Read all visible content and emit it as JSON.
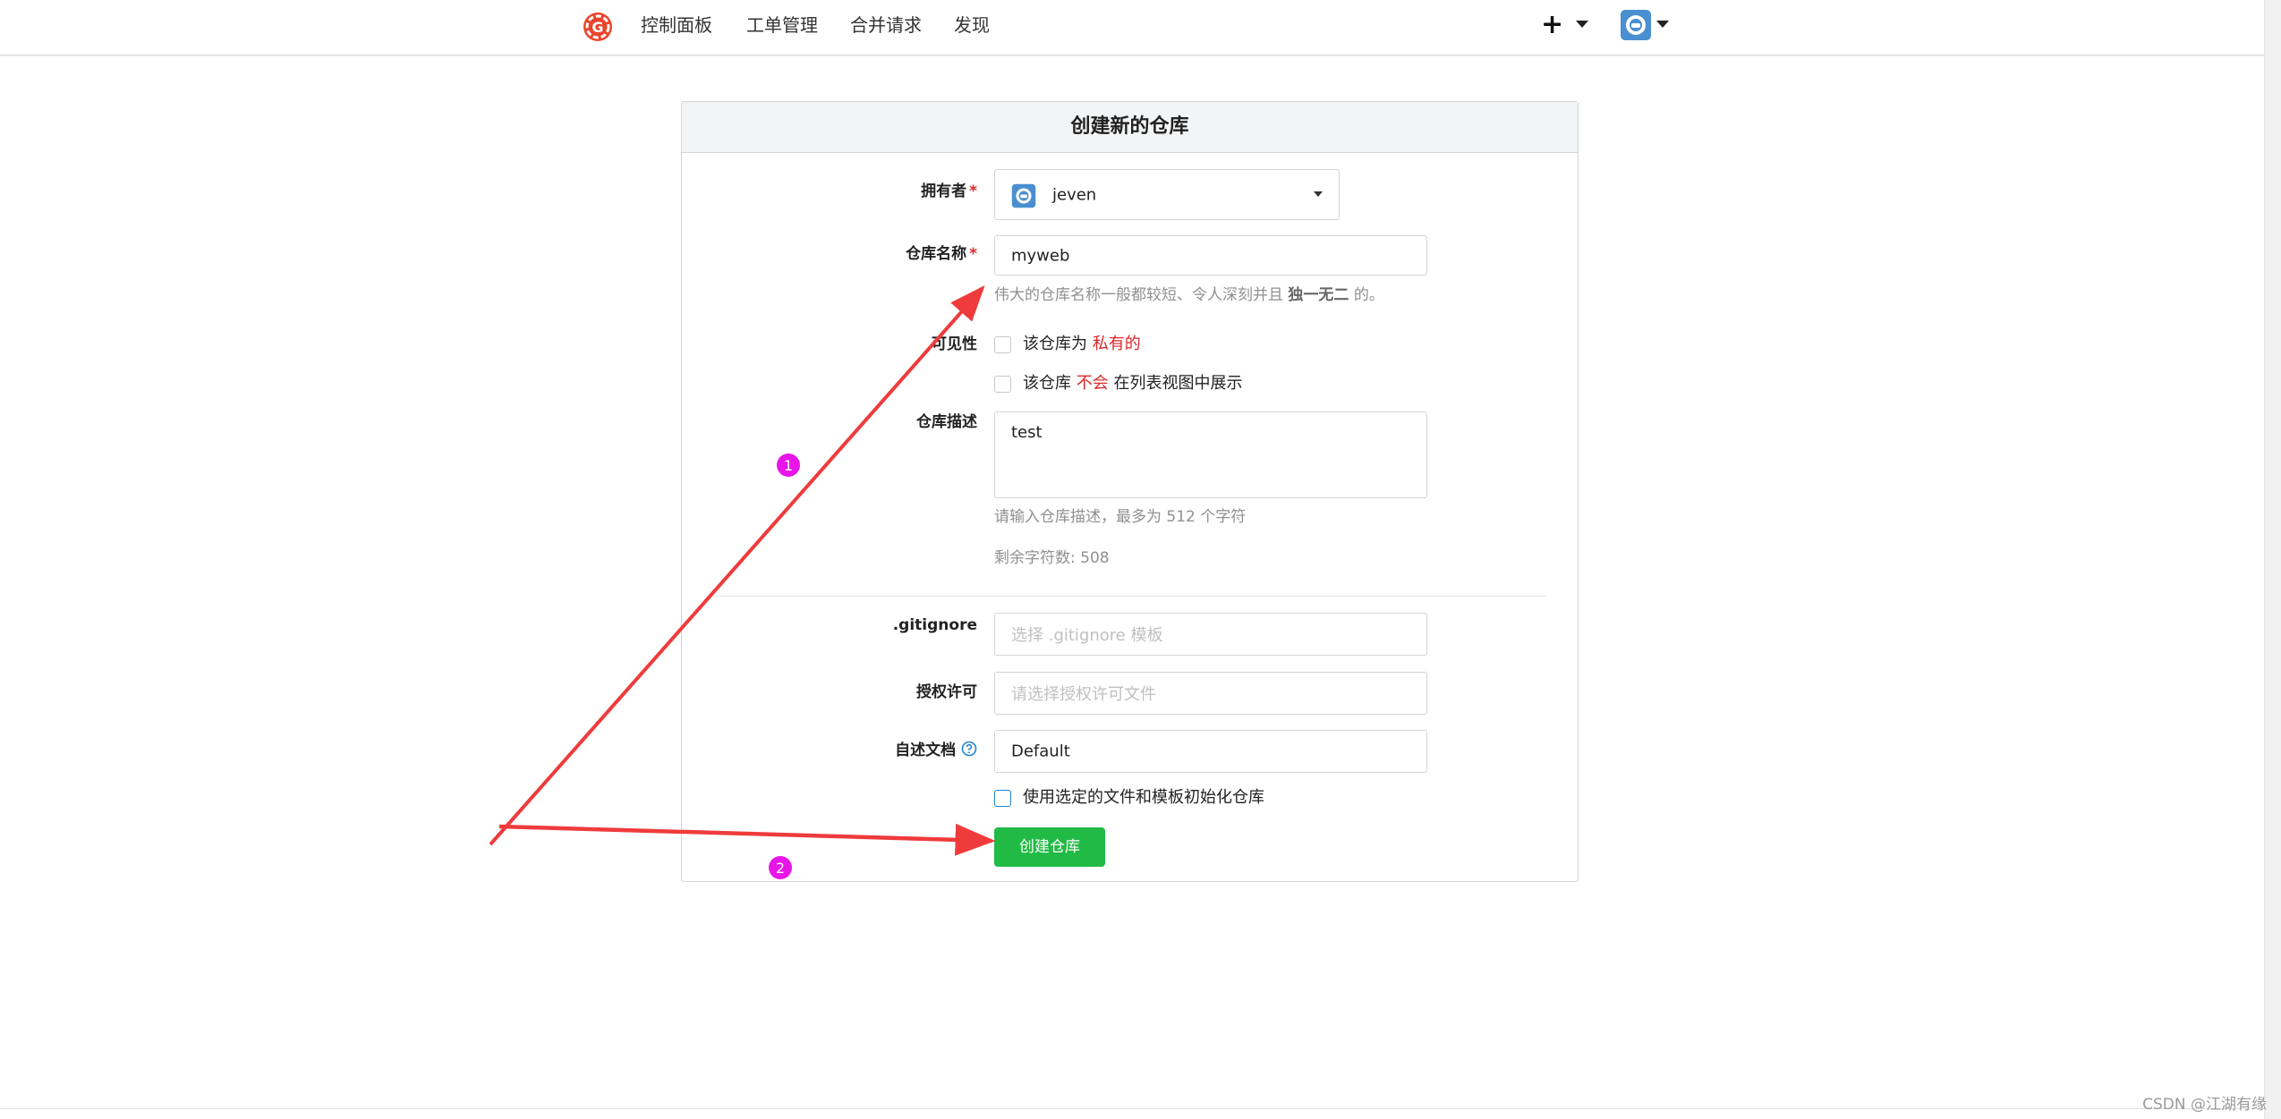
{
  "nav": {
    "items": [
      "控制面板",
      "工单管理",
      "合并请求",
      "发现"
    ],
    "plus_symbol": "+",
    "accent": "#e8452c"
  },
  "form": {
    "title": "创建新的仓库",
    "owner": {
      "label": "拥有者",
      "value": "jeven"
    },
    "repo_name": {
      "label": "仓库名称",
      "value": "myweb",
      "help_prefix": "伟大的仓库名称一般都较短、令人深刻并且",
      "help_emphasis": "独一无二",
      "help_suffix": "的。"
    },
    "visibility": {
      "label": "可见性",
      "private_prefix": "该仓库为",
      "private_highlight": "私有的",
      "template_prefix": "该仓库",
      "template_highlight": "不会",
      "template_suffix": "在列表视图中展示"
    },
    "description": {
      "label": "仓库描述",
      "value": "test",
      "help": "请输入仓库描述，最多为 512 个字符",
      "remaining": "剩余字符数: 508"
    },
    "gitignore": {
      "label": ".gitignore",
      "placeholder": "选择 .gitignore 模板"
    },
    "license": {
      "label": "授权许可",
      "placeholder": "请选择授权许可文件"
    },
    "readme": {
      "label": "自述文档",
      "value": "Default"
    },
    "auto_init_label": "使用选定的文件和模板初始化仓库",
    "submit_label": "创建仓库",
    "required_mark": "*"
  },
  "annotations": {
    "marker_1": "1",
    "marker_2": "2",
    "arrow_color": "#ef3b3b",
    "marker_color": "#e815e8"
  },
  "watermark": "CSDN @江湖有缘"
}
